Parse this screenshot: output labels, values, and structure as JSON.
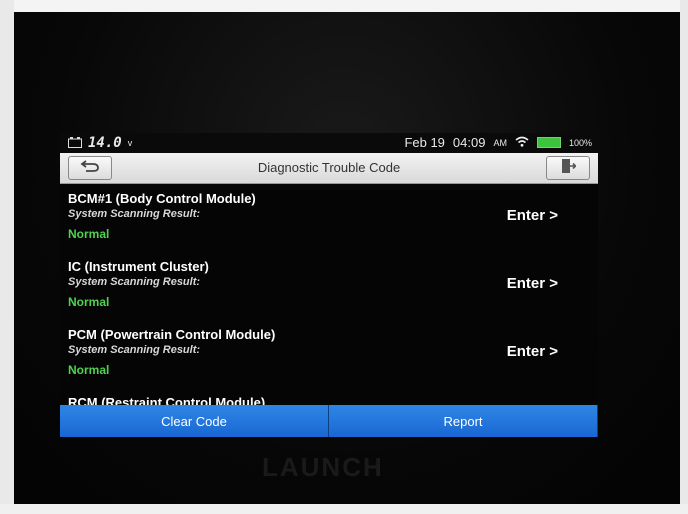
{
  "status": {
    "voltage": "14.0",
    "voltage_unit": "v",
    "date": "Feb 19",
    "time": "04:09",
    "ampm": "AM",
    "battery": "100%"
  },
  "titlebar": {
    "title": "Diagnostic Trouble Code",
    "back_icon": "back-arrow-icon",
    "exit_icon": "exit-icon"
  },
  "modules": [
    {
      "name": "BCM#1 (Body Control Module)",
      "label": "System Scanning Result:",
      "status": "Normal",
      "action": "Enter >"
    },
    {
      "name": "IC (Instrument Cluster)",
      "label": "System Scanning Result:",
      "status": "Normal",
      "action": "Enter >"
    },
    {
      "name": "PCM (Powertrain Control Module)",
      "label": "System Scanning Result:",
      "status": "Normal",
      "action": "Enter >"
    },
    {
      "name": "RCM (Restraint Control Module)",
      "label": "",
      "status": "",
      "action": ""
    }
  ],
  "bottom": {
    "clear_code": "Clear Code",
    "report": "Report"
  },
  "device": {
    "logo": "LAUNCH"
  },
  "colors": {
    "status_ok": "#4fd34f",
    "button_blue": "#1967d2"
  }
}
